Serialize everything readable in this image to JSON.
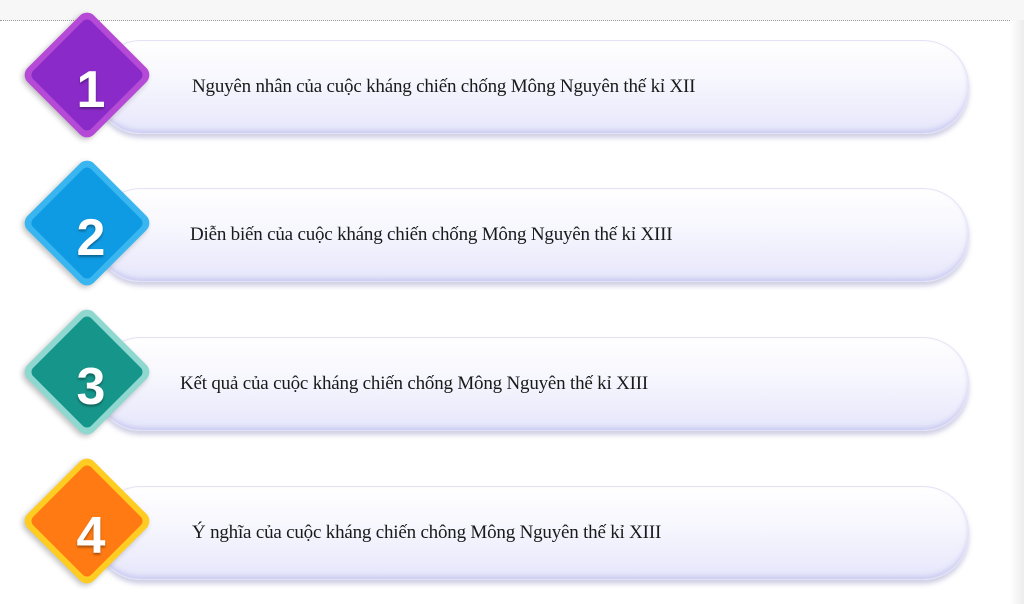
{
  "items": [
    {
      "number": "1",
      "text": "Nguyên nhân của cuộc kháng chiến chống Mông Nguyên thế kỉ XII",
      "outer_color": "#b54ad6",
      "inner_color": "#8a2bc9"
    },
    {
      "number": "2",
      "text": "Diễn biến của cuộc kháng chiến chống Mông Nguyên thế kỉ XIII",
      "outer_color": "#39b6f0",
      "inner_color": "#0f9be3"
    },
    {
      "number": "3",
      "text": "Kết quả của cuộc kháng chiến chống Mông Nguyên thế kỉ XIII",
      "outer_color": "#8fd8d0",
      "inner_color": "#16958a"
    },
    {
      "number": "4",
      "text": "Ý nghĩa của cuộc kháng chiến  chông Mông Nguyên thế kỉ XIII",
      "outer_color": "#ffcc22",
      "inner_color": "#ff7a12"
    }
  ]
}
